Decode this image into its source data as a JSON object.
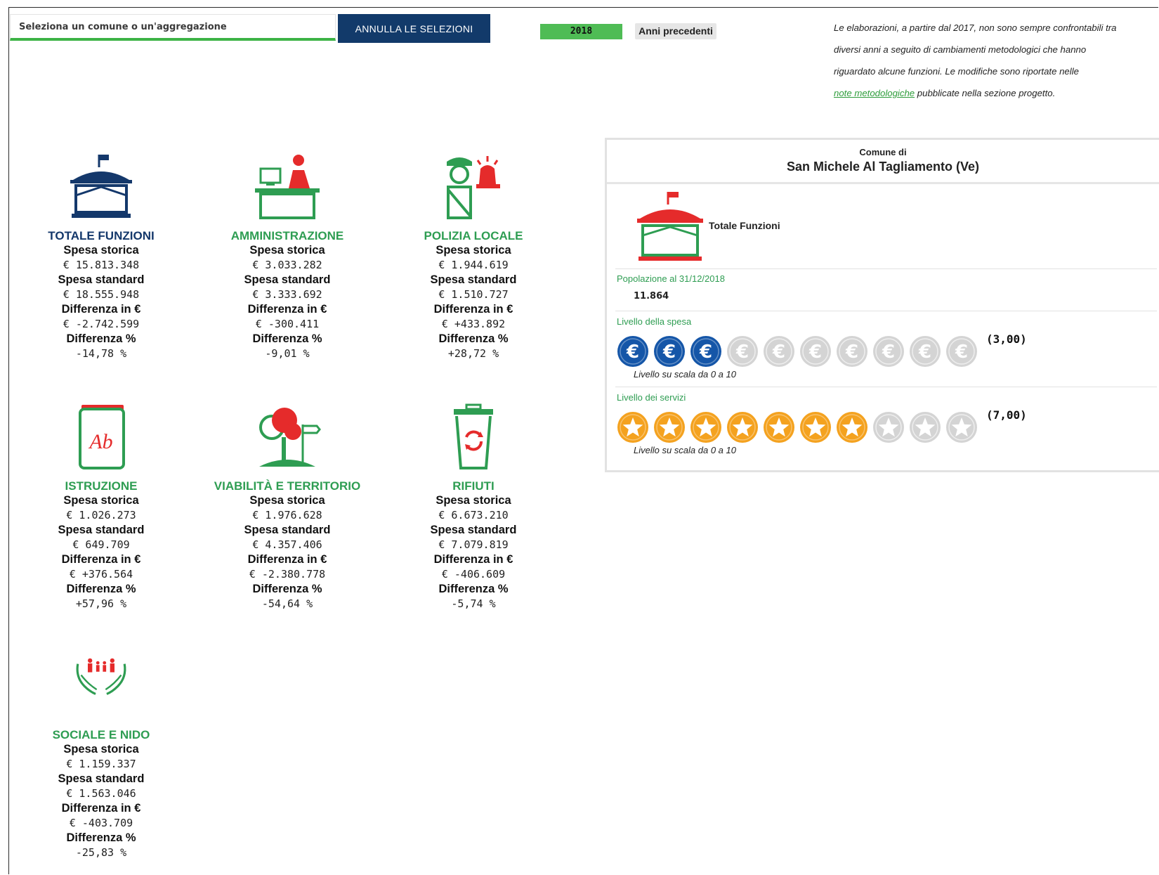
{
  "toolbar": {
    "search_placeholder": "Seleziona un comune o un'aggregazione",
    "reset_label": "ANNULLA LE SELEZIONI",
    "year_label": "2018",
    "prev_label": "Anni precedenti"
  },
  "note": {
    "line1": "Le elaborazioni, a partire dal 2017, non sono sempre confrontabili tra",
    "line2": "diversi anni a seguito di cambiamenti metodologici che hanno",
    "line3": "riguardato alcune funzioni. Le modifiche sono riportate nelle",
    "link": "note metodologiche",
    "line4_rest": " pubblicate nella sezione progetto."
  },
  "labels": {
    "spesa_storica": "Spesa storica",
    "spesa_standard": "Spesa standard",
    "diff_euro": "Differenza in €",
    "diff_pct": "Differenza %"
  },
  "functions": [
    {
      "title": "TOTALE FUNZIONI",
      "storica": "€ 15.813.348",
      "standard": "€ 18.555.948",
      "diff": "€ -2.742.599",
      "pct": "-14,78 %",
      "icon": "town-hall-icon"
    },
    {
      "title": "AMMINISTRAZIONE",
      "storica": "€ 3.033.282",
      "standard": "€ 3.333.692",
      "diff": "€ -300.411",
      "pct": "-9,01 %",
      "icon": "office-desk-icon"
    },
    {
      "title": "POLIZIA LOCALE",
      "storica": "€ 1.944.619",
      "standard": "€ 1.510.727",
      "diff": "€ +433.892",
      "pct": "+28,72 %",
      "icon": "police-officer-icon"
    },
    {
      "title": "ISTRUZIONE",
      "storica": "€ 1.026.273",
      "standard": "€ 649.709",
      "diff": "€ +376.564",
      "pct": "+57,96 %",
      "icon": "book-icon"
    },
    {
      "title": "VIABILITÀ E TERRITORIO",
      "storica": "€ 1.976.628",
      "standard": "€ 4.357.406",
      "diff": "€ -2.380.778",
      "pct": "-54,64 %",
      "icon": "tree-signpost-icon"
    },
    {
      "title": "RIFIUTI",
      "storica": "€ 6.673.210",
      "standard": "€ 7.079.819",
      "diff": "€ -406.609",
      "pct": "-5,74 %",
      "icon": "recycle-bin-icon"
    },
    {
      "title": "SOCIALE E NIDO",
      "storica": "€ 1.159.337",
      "standard": "€ 1.563.046",
      "diff": "€ -403.709",
      "pct": "-25,83 %",
      "icon": "family-hands-icon"
    }
  ],
  "panel": {
    "subtitle": "Comune di",
    "name": "San Michele Al Tagliamento (Ve)",
    "total_label": "Totale Funzioni",
    "pop_label": "Popolazione al 31/12/2018",
    "pop_value": "11.864",
    "spesa_label": "Livello della spesa",
    "spesa_score": "(3,00)",
    "spesa_level": 3,
    "servizi_label": "Livello dei servizi",
    "servizi_score": "(7,00)",
    "servizi_level": 7,
    "scale_text": "Livello su scala da 0 a 10"
  },
  "colors": {
    "green": "#2e9d52",
    "navy": "#14386b",
    "red": "#e52b2b",
    "euro_blue": "#1556a8",
    "star_orange": "#f4a21f",
    "inactive_gray": "#d4d4d4"
  }
}
